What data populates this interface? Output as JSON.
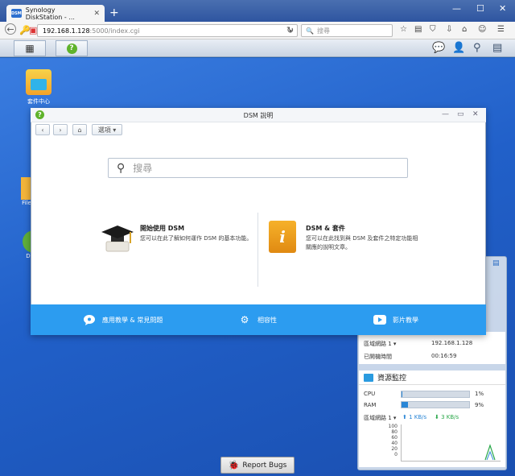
{
  "browser": {
    "tab_title": "Synology DiskStation - ...",
    "favicon_text": "DSM",
    "url_host": "192.168.1.128",
    "url_path": ":5000/index.cgi",
    "search_placeholder": "搜尋"
  },
  "desktop": {
    "icons": [
      {
        "label": "套件中心"
      },
      {
        "label": "File"
      },
      {
        "label": "D"
      }
    ]
  },
  "help_window": {
    "title": "DSM 說明",
    "menu_label": "選項 ▾",
    "search_placeholder": "搜尋",
    "cards": [
      {
        "title": "開始使用 DSM",
        "desc": "您可以在此了解如何運作 DSM 的基本功能。"
      },
      {
        "title": "DSM & 套件",
        "desc_line1": "您可以在此找到與 DSM 及套件之特定功能相",
        "desc_line2": "關應的說明文章。"
      }
    ],
    "footer": [
      {
        "label": "應用教學 & 常見問題",
        "icon": "chat-icon"
      },
      {
        "label": "相容性",
        "icon": "gears-icon"
      },
      {
        "label": "影片教學",
        "icon": "play-icon"
      }
    ]
  },
  "widget": {
    "network_label": "區域網路 1 ▾",
    "ip_value": "192.168.1.128",
    "uptime_label": "已開機時間",
    "uptime_value": "00:16:59",
    "monitor_title": "資源監控",
    "cpu_label": "CPU",
    "cpu_value": "1%",
    "cpu_fraction": 0.01,
    "ram_label": "RAM",
    "ram_value": "9%",
    "ram_fraction": 0.09,
    "lan_label": "區域網路 1 ▾",
    "upload": "1 KB/s",
    "download": "3 KB/s",
    "ticks": [
      "100",
      "80",
      "60",
      "40",
      "20",
      "0"
    ]
  },
  "report_button": "Report Bugs"
}
